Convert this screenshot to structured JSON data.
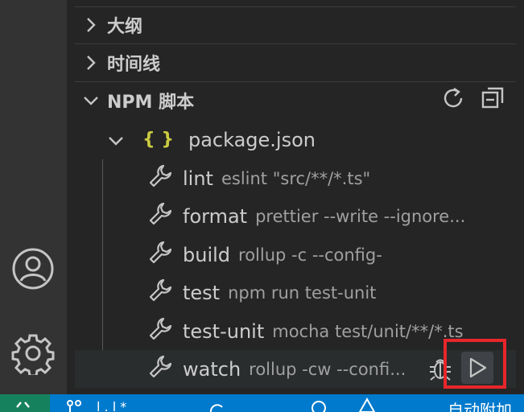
{
  "sections": {
    "outline": "大纲",
    "timeline": "时间线",
    "npm_scripts": "NPM 脚本"
  },
  "npm": {
    "file": "package.json",
    "brace": "{ }",
    "scripts": [
      {
        "name": "lint",
        "command": "eslint \"src/**/*.ts\""
      },
      {
        "name": "format",
        "command": "prettier --write --ignore..."
      },
      {
        "name": "build",
        "command": "rollup -c --config-"
      },
      {
        "name": "test",
        "command": "npm run test-unit"
      },
      {
        "name": "test-unit",
        "command": "mocha test/unit/**/*.ts"
      },
      {
        "name": "watch",
        "command": "rollup -cw --confi..."
      }
    ]
  },
  "statusbar": {
    "branch_fragment": "l   .   l   *",
    "right_fragment": "自动附加"
  },
  "colors": {
    "activity_bar": "#333333",
    "sidebar": "#252526",
    "statusbar": "#007acc",
    "remote": "#16825d",
    "json_icon": "#cbcb41",
    "highlight": "#e8262a"
  }
}
